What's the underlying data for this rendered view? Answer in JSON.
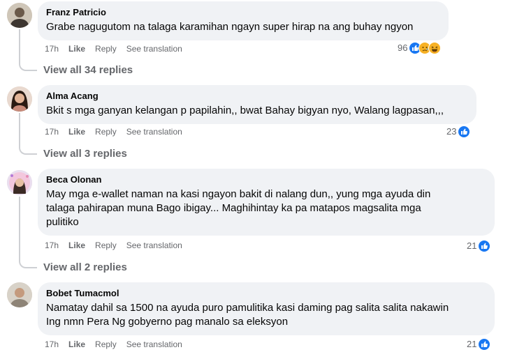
{
  "comments": [
    {
      "author": "Franz Patricio",
      "lines": [
        "Grabe nagugutom na talaga karamihan ngayn super hirap na ang buhay ngyon"
      ],
      "time": "17h",
      "like": "Like",
      "reply": "Reply",
      "translate": "See translation",
      "reaction_count": "96",
      "reactions": [
        "like-reaction-icon",
        "sad-reaction-icon",
        "haha-reaction-icon"
      ],
      "view_replies": "View all 34 replies"
    },
    {
      "author": "Alma Acang",
      "lines": [
        "Bkit s mga ganyan kelangan p papilahin,, bwat Bahay bigyan nyo, Walang lagpasan,,,"
      ],
      "time": "17h",
      "like": "Like",
      "reply": "Reply",
      "translate": "See translation",
      "reaction_count": "23",
      "reactions": [
        "like-reaction-icon"
      ],
      "view_replies": "View all 3 replies"
    },
    {
      "author": "Beca Olonan",
      "lines": [
        "May mga e-wallet naman na kasi ngayon bakit di nalang dun,, yung mga ayuda din",
        "talaga pahirapan muna Bago ibigay... Maghihintay ka pa matapos magsalita mga",
        "pulitiko"
      ],
      "time": "17h",
      "like": "Like",
      "reply": "Reply",
      "translate": "See translation",
      "reaction_count": "21",
      "reactions": [
        "like-reaction-icon"
      ],
      "view_replies": "View all 2 replies"
    },
    {
      "author": "Bobet Tumacmol",
      "lines": [
        "Namatay dahil sa 1500 na ayuda puro pamulitika kasi daming pag salita salita nakawin",
        "Ing nmn Pera Ng gobyerno pag manalo sa eleksyon"
      ],
      "time": "17h",
      "like": "Like",
      "reply": "Reply",
      "translate": "See translation",
      "reaction_count": "21",
      "reactions": [
        "like-reaction-icon"
      ]
    }
  ],
  "colors": {
    "bubble": "#f0f2f5",
    "meta_text": "#65676b",
    "like_blue": "#1877f2",
    "emoji_yellow": "#f7b125"
  }
}
